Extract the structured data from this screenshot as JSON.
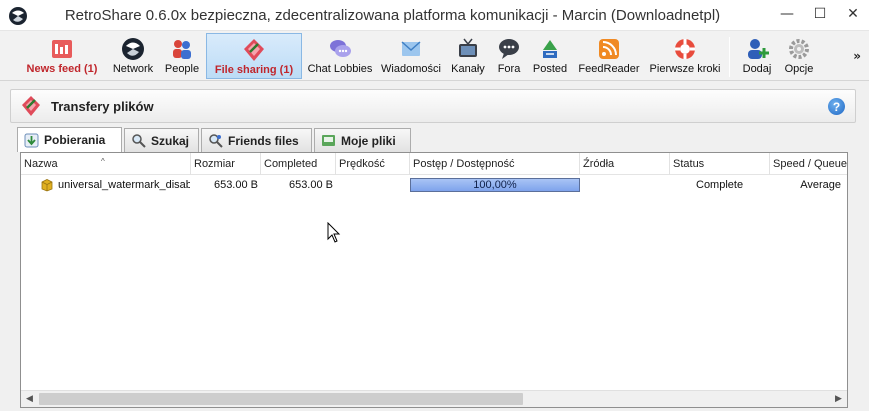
{
  "window": {
    "title": "RetroShare 0.6.0x bezpieczna, zdecentralizowana platforma komunikacji - Marcin (Downloadnetpl)",
    "minimize_glyph": "—",
    "maximize_glyph": "☐",
    "close_glyph": "✕"
  },
  "toolbar": {
    "items": [
      {
        "label": "News feed (1)",
        "icon": "news-feed-icon"
      },
      {
        "label": "Network",
        "icon": "network-icon"
      },
      {
        "label": "People",
        "icon": "people-icon"
      },
      {
        "label": "File sharing (1)",
        "icon": "file-sharing-icon"
      },
      {
        "label": "Chat Lobbies",
        "icon": "chat-lobbies-icon"
      },
      {
        "label": "Wiadomości",
        "icon": "messages-icon"
      },
      {
        "label": "Kanały",
        "icon": "channels-icon"
      },
      {
        "label": "Fora",
        "icon": "forums-icon"
      },
      {
        "label": "Posted",
        "icon": "posted-icon"
      },
      {
        "label": "FeedReader",
        "icon": "feedreader-icon"
      },
      {
        "label": "Pierwsze kroki",
        "icon": "getting-started-icon"
      },
      {
        "label": "Dodaj",
        "icon": "add-friend-icon"
      },
      {
        "label": "Opcje",
        "icon": "options-gear-icon"
      }
    ],
    "more_glyph": "»"
  },
  "panel": {
    "title": "Transfery plików",
    "help_glyph": "?"
  },
  "tabs": [
    {
      "label": "Pobierania",
      "icon": "downloads-icon"
    },
    {
      "label": "Szukaj",
      "icon": "search-icon"
    },
    {
      "label": "Friends files",
      "icon": "friends-files-icon"
    },
    {
      "label": "Moje pliki",
      "icon": "my-files-icon"
    }
  ],
  "table": {
    "columns": [
      "Nazwa",
      "Rozmiar",
      "Completed",
      "Prędkość",
      "Postęp / Dostępność",
      "Źródła",
      "Status",
      "Speed / Queue"
    ],
    "rows": [
      {
        "name": "universal_watermark_disab",
        "size": "653.00 B",
        "completed": "653.00 B",
        "speed": "",
        "progress_text": "100,00%",
        "progress_value": 100,
        "sources": "",
        "status": "Complete",
        "speed_queue": "Average"
      }
    ]
  },
  "scrollbar": {
    "left_glyph": "◀",
    "right_glyph": "▶"
  },
  "colors": {
    "alert_text": "#c0262c",
    "active_tab_bg": "#bcdcf6",
    "progress_fill": "#7ea3ec"
  }
}
